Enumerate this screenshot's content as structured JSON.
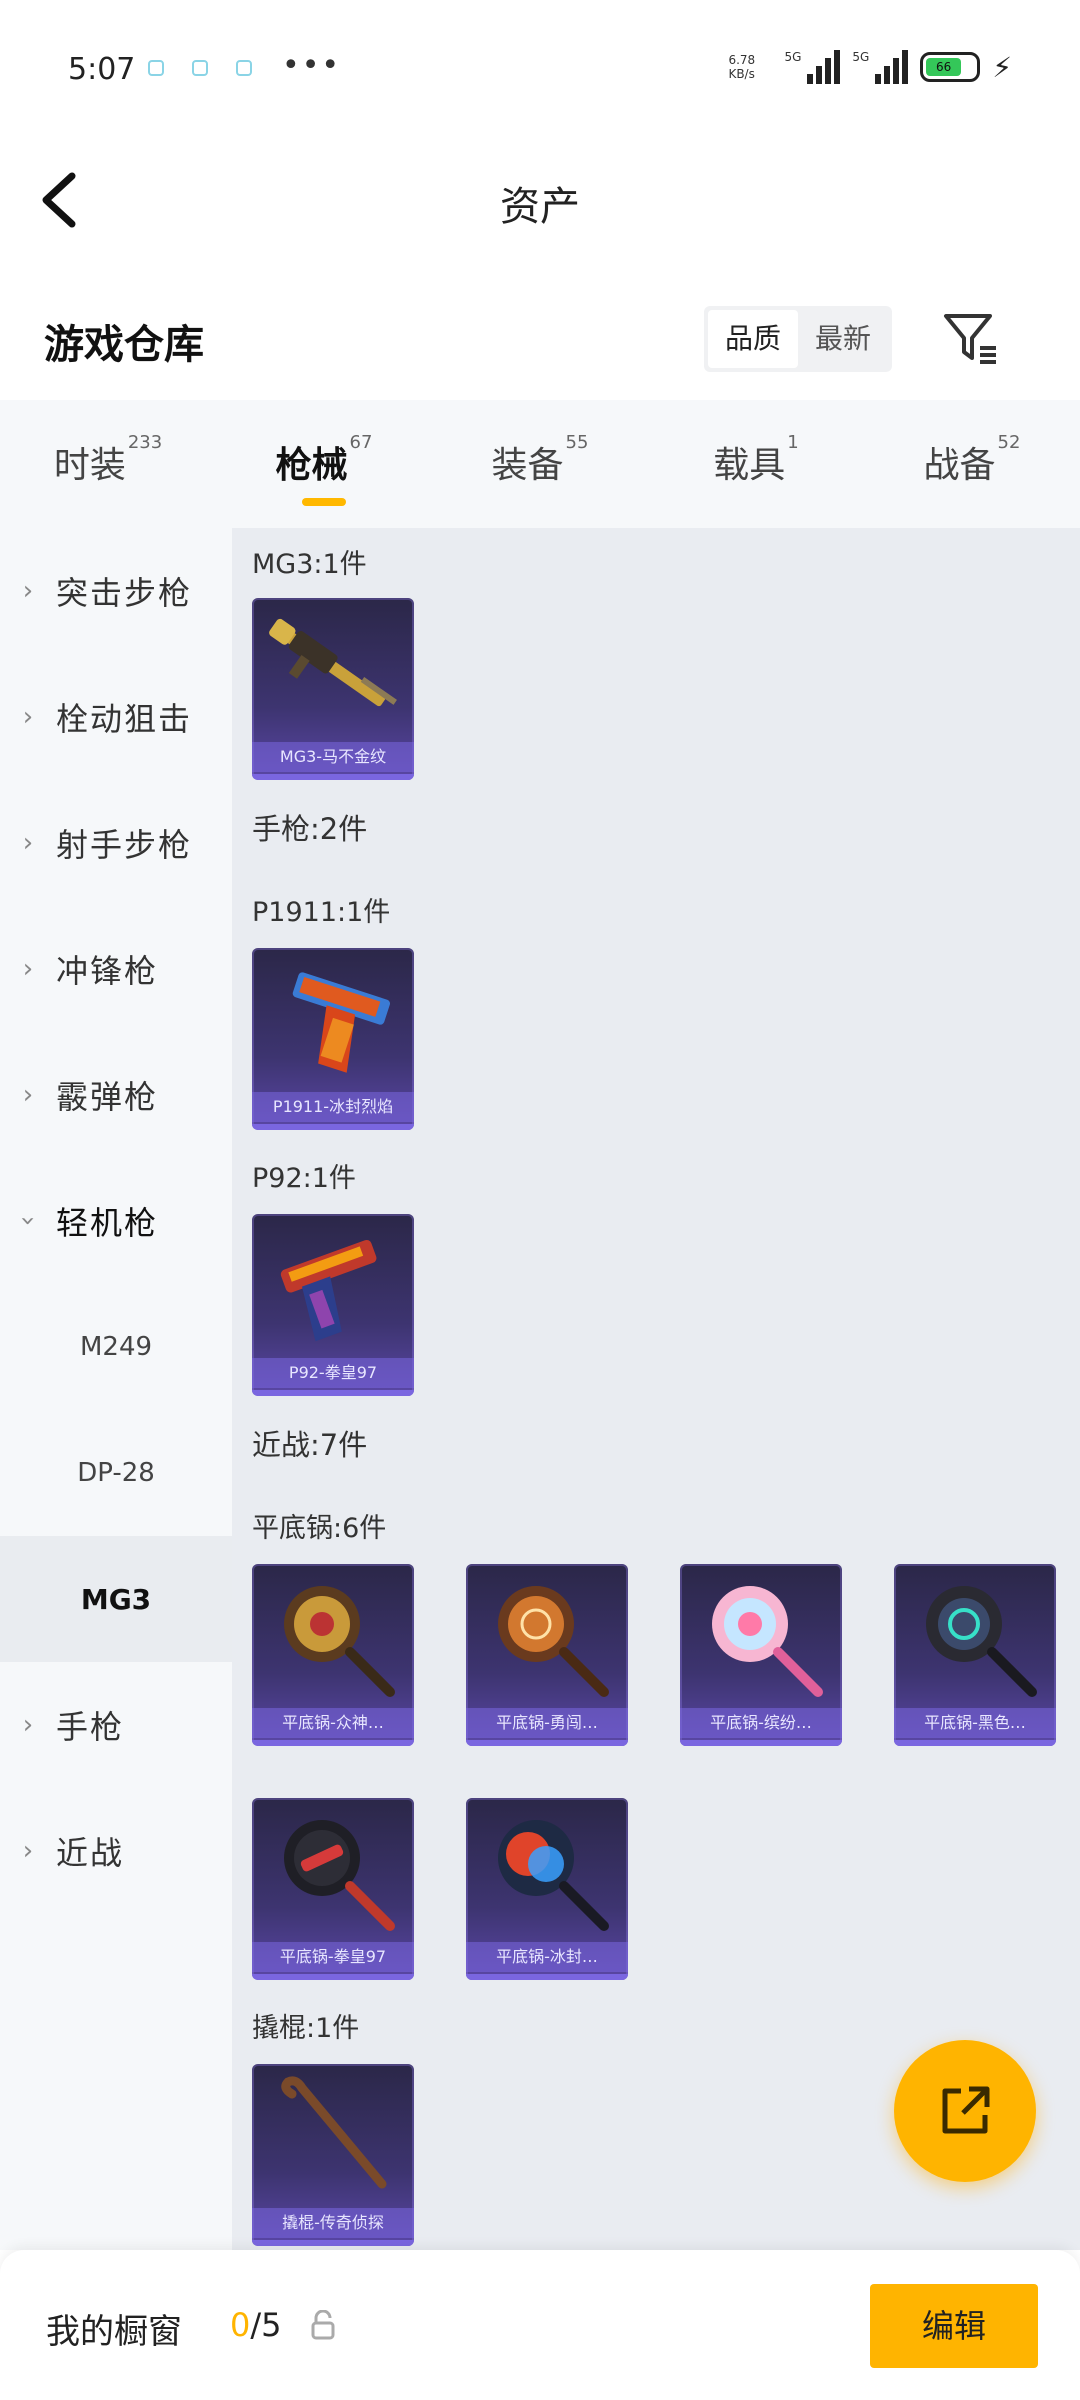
{
  "status_bar": {
    "time": "5:07",
    "net_speed_value": "6.78",
    "net_speed_unit": "KB/s",
    "signal1_label": "5G",
    "signal2_label": "5G",
    "battery": "66"
  },
  "nav": {
    "title": "资产"
  },
  "warehouse": {
    "title": "游戏仓库",
    "sort_options": [
      "品质",
      "最新"
    ]
  },
  "tabs": [
    {
      "label": "时装",
      "count": "233"
    },
    {
      "label": "枪械",
      "count": "67"
    },
    {
      "label": "装备",
      "count": "55"
    },
    {
      "label": "载具",
      "count": "1"
    },
    {
      "label": "战备",
      "count": "52"
    }
  ],
  "sidebar": {
    "categories": [
      {
        "label": "突击步枪"
      },
      {
        "label": "栓动狙击"
      },
      {
        "label": "射手步枪"
      },
      {
        "label": "冲锋枪"
      },
      {
        "label": "霰弹枪"
      },
      {
        "label": "轻机枪"
      }
    ],
    "sub_items": [
      "M249",
      "DP-28",
      "MG3"
    ],
    "bottom_categories": [
      {
        "label": "手枪"
      },
      {
        "label": "近战"
      }
    ]
  },
  "content": {
    "sections": {
      "mg3_count": "MG3:1件",
      "pistol_count": "手枪:2件",
      "p1911_count": "P1911:1件",
      "p92_count": "P92:1件",
      "melee_count": "近战:7件",
      "pan_count": "平底锅:6件",
      "crowbar_count": "撬棍:1件"
    },
    "items": {
      "mg3": "MG3-马不金纹",
      "p1911": "P1911-冰封烈焰",
      "p92": "P92-拳皇97",
      "pan1": "平底锅-众神…",
      "pan2": "平底锅-勇闯…",
      "pan3": "平底锅-缤纷…",
      "pan4": "平底锅-黑色…",
      "pan5": "平底锅-拳皇97",
      "pan6": "平底锅-冰封…",
      "crowbar": "撬棍-传奇侦探"
    }
  },
  "bottom_bar": {
    "window_label": "我的橱窗",
    "window_current": "0",
    "window_total": "/5",
    "edit_label": "编辑"
  },
  "colors": {
    "accent": "#ffb400",
    "card_bg": "#3d3470",
    "content_bg": "#e9ecf1"
  }
}
